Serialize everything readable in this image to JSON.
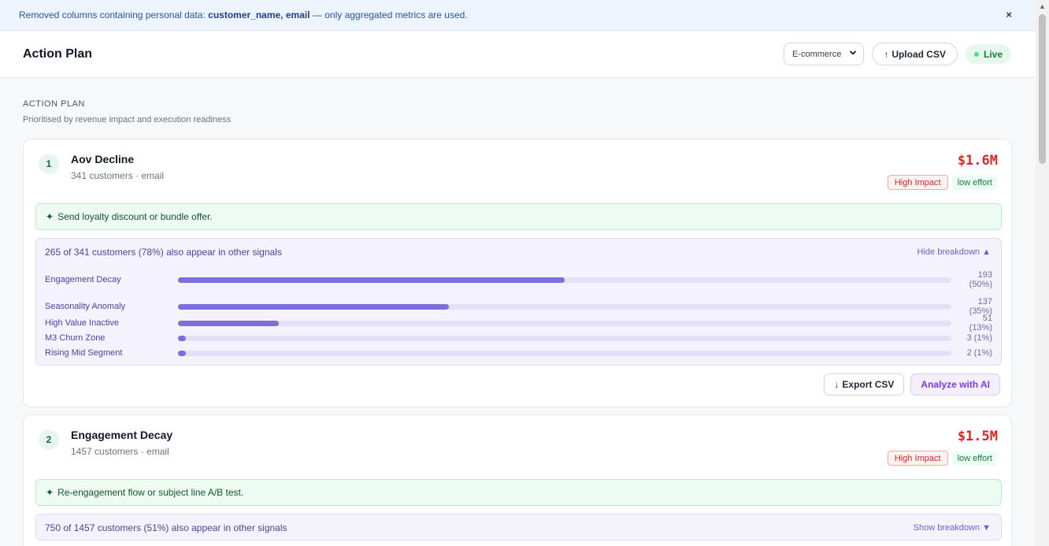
{
  "banner": {
    "prefix": "Removed columns containing personal data: ",
    "columns": "customer_name, email",
    "suffix": " — only aggregated metrics are used.",
    "close": "×"
  },
  "header": {
    "title": "Action Plan",
    "vertical_select": "E-commerce",
    "upload_label": "Upload CSV",
    "live_label": "Live"
  },
  "section": {
    "eyebrow": "ACTION PLAN",
    "subtitle": "Prioritised by revenue impact and execution readiness"
  },
  "cards": [
    {
      "rank": "1",
      "title": "Aov Decline",
      "meta": "341 customers · email",
      "amount": "$1.6M",
      "impact": "High Impact",
      "effort": "low effort",
      "recommendation": "Send loyalty discount or bundle offer.",
      "overlap_text": "265 of 341 customers (78%) also appear in other signals",
      "toggle": "Hide breakdown",
      "breakdown": [
        {
          "label": "Engagement Decay",
          "count": "193",
          "pct": "(50%)",
          "ratio": 0.5
        },
        {
          "label": "Seasonality Anomaly",
          "count": "137",
          "pct": "(35%)",
          "ratio": 0.35
        },
        {
          "label": "High Value Inactive",
          "count": "51",
          "pct": "(13%)",
          "ratio": 0.13
        },
        {
          "label": "M3 Churn Zone",
          "count": "3",
          "pct": "(1%)",
          "ratio": 0.01
        },
        {
          "label": "Rising Mid Segment",
          "count": "2",
          "pct": "(1%)",
          "ratio": 0.01
        }
      ],
      "export_label": "Export CSV",
      "ai_label": "Analyze with AI"
    },
    {
      "rank": "2",
      "title": "Engagement Decay",
      "meta": "1457 customers · email",
      "amount": "$1.5M",
      "impact": "High Impact",
      "effort": "low effort",
      "recommendation": "Re-engagement flow or subject line A/B test.",
      "overlap_text": "750 of 1457 customers (51%) also appear in other signals",
      "toggle": "Show breakdown"
    }
  ],
  "colors": {
    "accent_purple": "#7b6fdc",
    "impact_red": "#dc2626",
    "live_green": "#15803d"
  }
}
